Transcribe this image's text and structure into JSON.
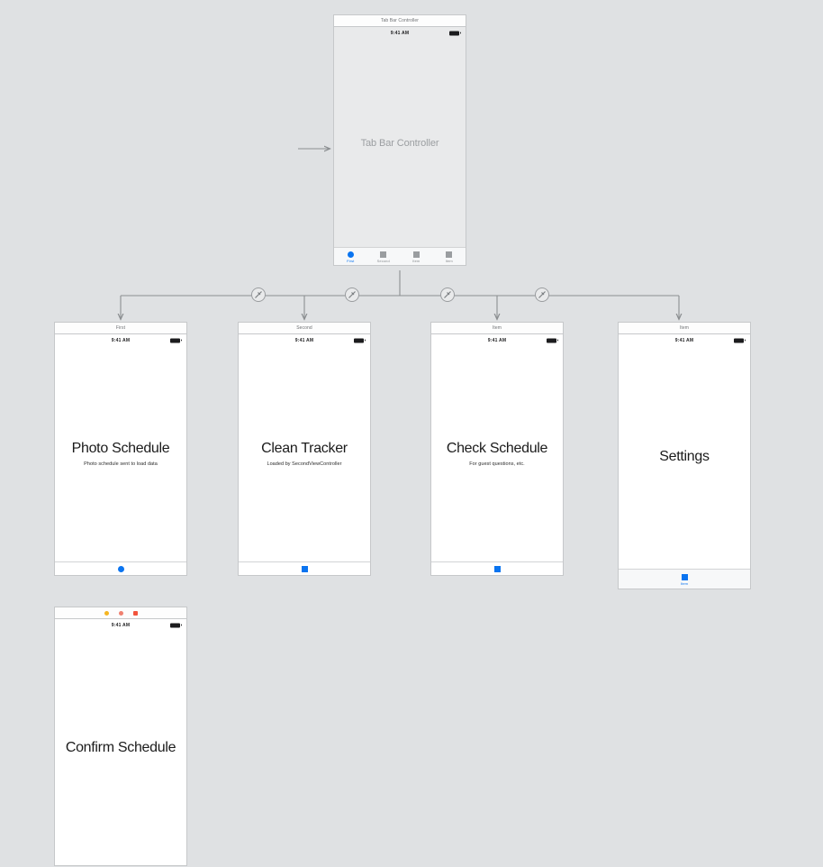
{
  "canvas": {
    "background": "#dfe1e3",
    "accent": "#0a74f0"
  },
  "entry_point": {
    "name": "storyboard-entry-point-arrow"
  },
  "scenes": [
    {
      "id": "tab-bar-controller",
      "title": "Tab Bar Controller",
      "status_time": "9:41 AM",
      "placeholder": "Tab Bar Controller",
      "tabs": [
        {
          "label": "First",
          "icon": "circle-icon",
          "selected": true
        },
        {
          "label": "Second",
          "icon": "square-icon",
          "selected": false
        },
        {
          "label": "Item",
          "icon": "square-icon",
          "selected": false
        },
        {
          "label": "Item",
          "icon": "square-icon",
          "selected": false
        }
      ]
    },
    {
      "id": "first-scene",
      "title": "First",
      "status_time": "9:41 AM",
      "headline": "Photo Schedule",
      "subline": "Photo schedule sent to load data",
      "footer_marker": "circle-icon"
    },
    {
      "id": "second-scene",
      "title": "Second",
      "status_time": "9:41 AM",
      "headline": "Clean Tracker",
      "subline": "Loaded by SecondViewController",
      "footer_marker": "square-icon"
    },
    {
      "id": "third-scene",
      "title": "Item",
      "status_time": "9:41 AM",
      "headline": "Check Schedule",
      "subline": "For guest questions, etc.",
      "footer_marker": "square-icon"
    },
    {
      "id": "fourth-scene",
      "title": "Item",
      "status_time": "9:41 AM",
      "headline": "Settings",
      "subline": "",
      "tab": {
        "label": "Item",
        "icon": "square-icon",
        "selected": true
      }
    },
    {
      "id": "confirm-scene",
      "title": "",
      "status_time": "9:41 AM",
      "headline": "Confirm Schedule",
      "subline": "",
      "size_class_dots": [
        {
          "name": "size-class-dot-yellow",
          "color": "#f5b521",
          "shape": "circle"
        },
        {
          "name": "size-class-dot-pink",
          "color": "#f08070",
          "shape": "circle"
        },
        {
          "name": "size-class-dot-red",
          "color": "#f2543c",
          "shape": "square"
        }
      ]
    }
  ],
  "segues": [
    {
      "name": "relationship-segue-first",
      "kind": "relationship"
    },
    {
      "name": "relationship-segue-second",
      "kind": "relationship"
    },
    {
      "name": "relationship-segue-third",
      "kind": "relationship"
    },
    {
      "name": "relationship-segue-fourth",
      "kind": "relationship"
    }
  ]
}
